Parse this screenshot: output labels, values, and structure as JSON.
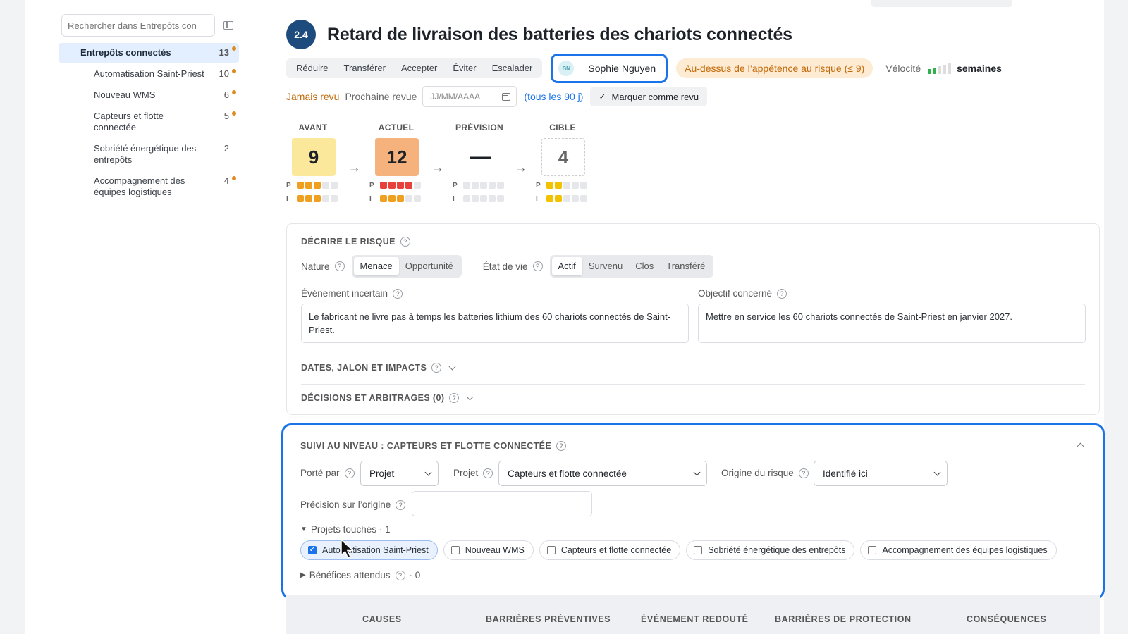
{
  "sidebar": {
    "search_placeholder": "Rechercher dans Entrepôts con",
    "items": [
      {
        "label": "Entrepôts connectés",
        "count": "13",
        "dot": true
      },
      {
        "label": "Automatisation Saint-Priest",
        "count": "10",
        "dot": true
      },
      {
        "label": "Nouveau WMS",
        "count": "6",
        "dot": true
      },
      {
        "label": "Capteurs et flotte connectée",
        "count": "5",
        "dot": true
      },
      {
        "label": "Sobriété énergétique des entrepôts",
        "count": "2",
        "dot": false
      },
      {
        "label": "Accompagnement des équipes logistiques",
        "count": "4",
        "dot": true
      }
    ]
  },
  "risk": {
    "id": "2.4",
    "title": "Retard de livraison des batteries des chariots connectés",
    "actions": [
      "Réduire",
      "Transférer",
      "Accepter",
      "Éviter",
      "Escalader"
    ],
    "owner_initials": "SN",
    "owner_name": "Sophie Nguyen",
    "appetite": "Au-dessus de l’appétence au risque (≤ 9)",
    "velocity_label": "Vélocité",
    "velocity_unit": "semaines",
    "velocity_level": 2,
    "never_reviewed": "Jamais revu",
    "next_review_label": "Prochaine revue",
    "date_placeholder": "JJ/MM/AAAA",
    "every": "(tous les 90 j)",
    "mark_reviewed": "Marquer comme revu"
  },
  "scores": [
    {
      "label": "AVANT",
      "value": "9",
      "p": 3,
      "i": 3,
      "color": "#fbe89a",
      "sq": "#f0a020"
    },
    {
      "label": "ACTUEL",
      "value": "12",
      "p": 4,
      "i": 3,
      "color": "#f6b27c",
      "sq_p": "#e8403a",
      "sq": "#f0a020"
    },
    {
      "label": "PRÉVISION",
      "value": "—",
      "p": 0,
      "i": 0
    },
    {
      "label": "CIBLE",
      "value": "4",
      "p": 2,
      "i": 2,
      "sq": "#f2c200"
    }
  ],
  "describe": {
    "title": "DÉCRIRE LE RISQUE",
    "nature_label": "Nature",
    "nature_options": [
      "Menace",
      "Opportunité"
    ],
    "state_label": "État de vie",
    "state_options": [
      "Actif",
      "Survenu",
      "Clos",
      "Transféré"
    ],
    "event_label": "Événement incertain",
    "event_text": "Le fabricant ne livre pas à temps les batteries lithium des 60 chariots connectés de Saint-Priest.",
    "objective_label": "Objectif concerné",
    "objective_text": "Mettre en service les 60 chariots connectés de Saint-Priest en janvier 2027.",
    "dates_title": "DATES, JALON ET IMPACTS",
    "decisions_title": "DÉCISIONS ET ARBITRAGES (0)"
  },
  "suivi": {
    "title": "SUIVI AU NIVEAU : CAPTEURS ET FLOTTE CONNECTÉE",
    "carried_label": "Porté par",
    "carried_value": "Projet",
    "project_label": "Projet",
    "project_value": "Capteurs et flotte connectée",
    "origin_label": "Origine du risque",
    "origin_value": "Identifié ici",
    "precision_label": "Précision sur l’origine",
    "touched_label": "Projets touchés · 1",
    "projects": [
      {
        "label": "Automatisation Saint-Priest",
        "checked": true
      },
      {
        "label": "Nouveau WMS",
        "checked": false
      },
      {
        "label": "Capteurs et flotte connectée",
        "checked": false
      },
      {
        "label": "Sobriété énergétique des entrepôts",
        "checked": false
      },
      {
        "label": "Accompagnement des équipes logistiques",
        "checked": false
      }
    ],
    "benefits_label": "Bénéfices attendus",
    "benefits_count": "· 0"
  },
  "bowtie": [
    "CAUSES",
    "BARRIÈRES PRÉVENTIVES",
    "ÉVÉNEMENT REDOUTÉ",
    "BARRIÈRES DE PROTECTION",
    "CONSÉQUENCES"
  ]
}
